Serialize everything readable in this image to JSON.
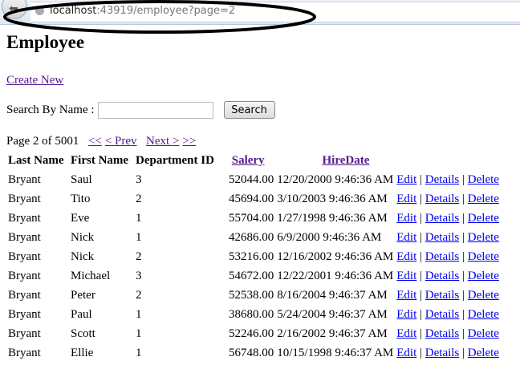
{
  "browser": {
    "url_host": "localhost",
    "url_rest": ":43919/employee?page=2"
  },
  "page": {
    "title": "Employee",
    "create_new": "Create New"
  },
  "search": {
    "label": "Search By Name :",
    "value": "",
    "button": "Search"
  },
  "pager": {
    "text": "Page 2 of 5001",
    "first": "<<",
    "prev": "< Prev",
    "next": "Next >",
    "last": ">>"
  },
  "table": {
    "headers": [
      "Last Name",
      "First Name",
      "Department ID",
      "Salery",
      "HireDate"
    ],
    "actions": {
      "edit": "Edit",
      "details": "Details",
      "delete": "Delete",
      "sep": "|"
    },
    "rows": [
      [
        "Bryant",
        "Saul",
        "3",
        "52044.00",
        "12/20/2000 9:46:36 AM"
      ],
      [
        "Bryant",
        "Tito",
        "2",
        "45694.00",
        "3/10/2003 9:46:36 AM"
      ],
      [
        "Bryant",
        "Eve",
        "1",
        "55704.00",
        "1/27/1998 9:46:36 AM"
      ],
      [
        "Bryant",
        "Nick",
        "1",
        "42686.00",
        "6/9/2000 9:46:36 AM"
      ],
      [
        "Bryant",
        "Nick",
        "2",
        "53216.00",
        "12/16/2002 9:46:36 AM"
      ],
      [
        "Bryant",
        "Michael",
        "3",
        "54672.00",
        "12/22/2001 9:46:36 AM"
      ],
      [
        "Bryant",
        "Peter",
        "2",
        "52538.00",
        "8/16/2004 9:46:37 AM"
      ],
      [
        "Bryant",
        "Paul",
        "1",
        "38680.00",
        "5/24/2004 9:46:37 AM"
      ],
      [
        "Bryant",
        "Scott",
        "1",
        "52246.00",
        "2/16/2002 9:46:37 AM"
      ],
      [
        "Bryant",
        "Ellie",
        "1",
        "56748.00",
        "10/15/1998 9:46:37 AM"
      ]
    ]
  }
}
